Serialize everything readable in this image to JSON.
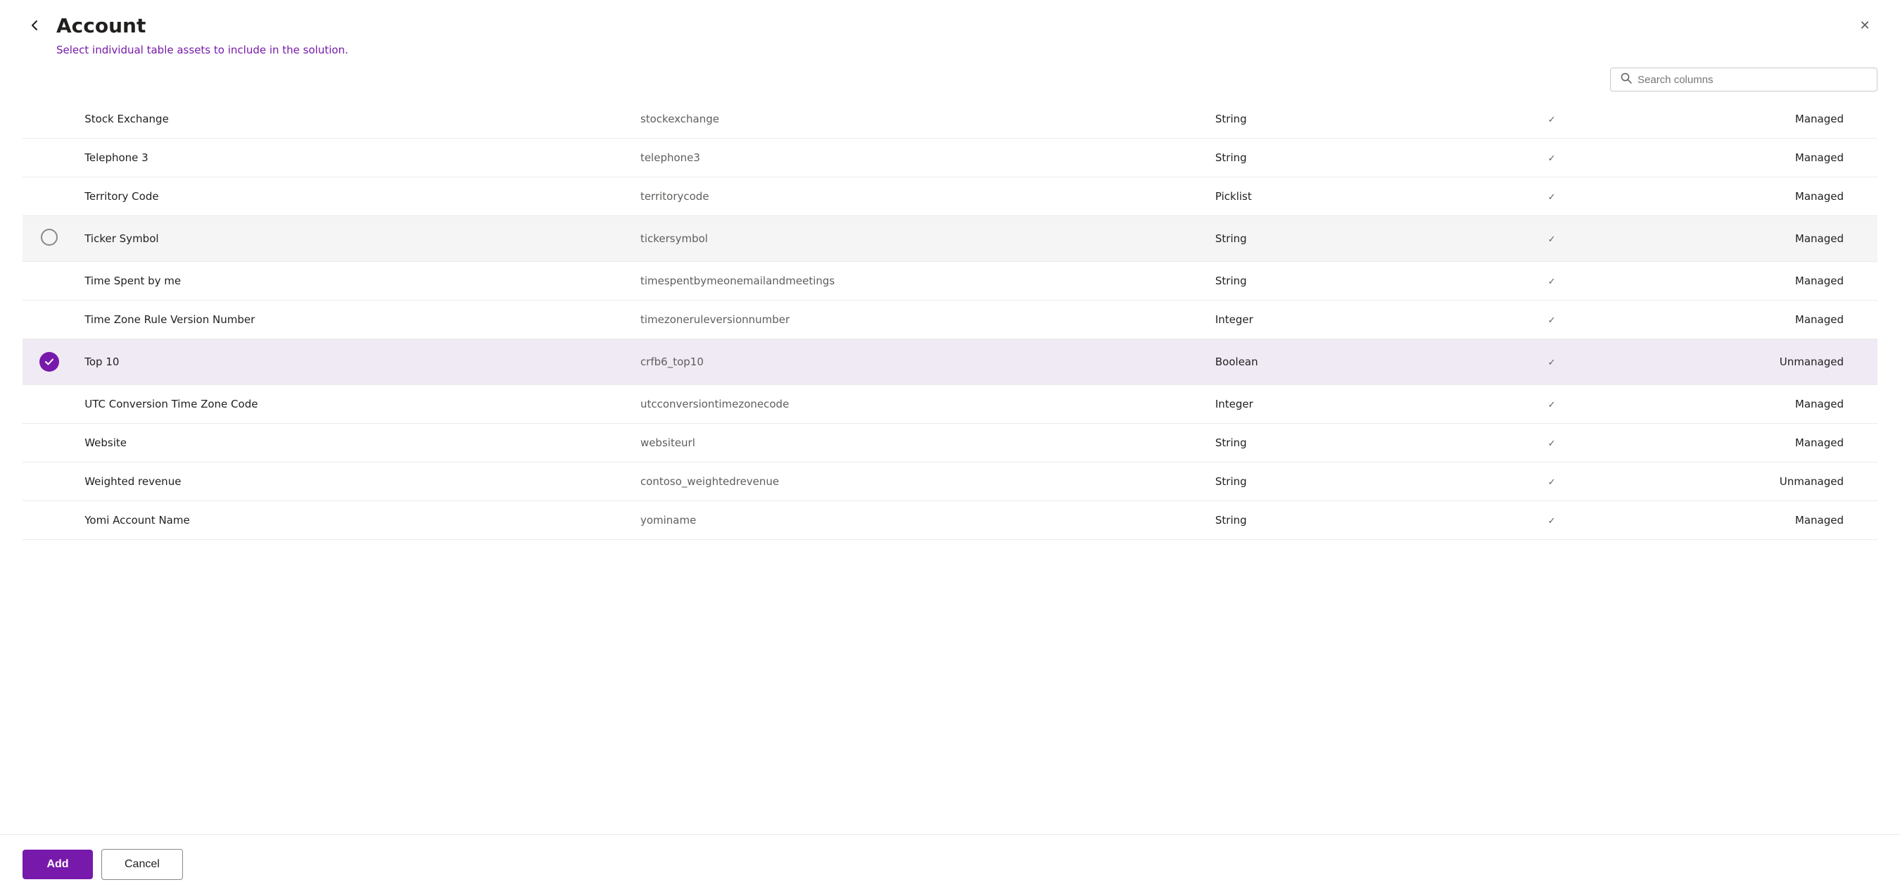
{
  "header": {
    "title": "Account",
    "back_label": "←",
    "close_label": "✕"
  },
  "subtitle": {
    "text_before": "Select ",
    "highlight1": "individual table assets",
    "text_middle": " to ",
    "highlight2": "include in the solution",
    "text_after": "."
  },
  "search": {
    "placeholder": "Search columns"
  },
  "rows": [
    {
      "id": 1,
      "state": "none",
      "name": "Stock Exchange",
      "logical": "stockexchange",
      "type": "String",
      "hasCheck": true,
      "managed": "Managed",
      "highlighted": false,
      "selected": false
    },
    {
      "id": 2,
      "state": "none",
      "name": "Telephone 3",
      "logical": "telephone3",
      "type": "String",
      "hasCheck": true,
      "managed": "Managed",
      "highlighted": false,
      "selected": false
    },
    {
      "id": 3,
      "state": "none",
      "name": "Territory Code",
      "logical": "territorycode",
      "type": "Picklist",
      "hasCheck": true,
      "managed": "Managed",
      "highlighted": false,
      "selected": false
    },
    {
      "id": 4,
      "state": "empty",
      "name": "Ticker Symbol",
      "logical": "tickersymbol",
      "type": "String",
      "hasCheck": true,
      "managed": "Managed",
      "highlighted": true,
      "selected": false
    },
    {
      "id": 5,
      "state": "none",
      "name": "Time Spent by me",
      "logical": "timespentbymeonemailandmeetings",
      "type": "String",
      "hasCheck": true,
      "managed": "Managed",
      "highlighted": false,
      "selected": false
    },
    {
      "id": 6,
      "state": "none",
      "name": "Time Zone Rule Version Number",
      "logical": "timezoneruleversionnumber",
      "type": "Integer",
      "hasCheck": true,
      "managed": "Managed",
      "highlighted": false,
      "selected": false
    },
    {
      "id": 7,
      "state": "checked",
      "name": "Top 10",
      "logical": "crfb6_top10",
      "type": "Boolean",
      "hasCheck": true,
      "managed": "Unmanaged",
      "highlighted": true,
      "selected": true
    },
    {
      "id": 8,
      "state": "none",
      "name": "UTC Conversion Time Zone Code",
      "logical": "utcconversiontimezonecode",
      "type": "Integer",
      "hasCheck": true,
      "managed": "Managed",
      "highlighted": false,
      "selected": false
    },
    {
      "id": 9,
      "state": "none",
      "name": "Website",
      "logical": "websiteurl",
      "type": "String",
      "hasCheck": true,
      "managed": "Managed",
      "highlighted": false,
      "selected": false
    },
    {
      "id": 10,
      "state": "none",
      "name": "Weighted revenue",
      "logical": "contoso_weightedrevenue",
      "type": "String",
      "hasCheck": true,
      "managed": "Unmanaged",
      "highlighted": false,
      "selected": false
    },
    {
      "id": 11,
      "state": "none",
      "name": "Yomi Account Name",
      "logical": "yominame",
      "type": "String",
      "hasCheck": true,
      "managed": "Managed",
      "highlighted": false,
      "selected": false
    }
  ],
  "footer": {
    "add_label": "Add",
    "cancel_label": "Cancel"
  }
}
